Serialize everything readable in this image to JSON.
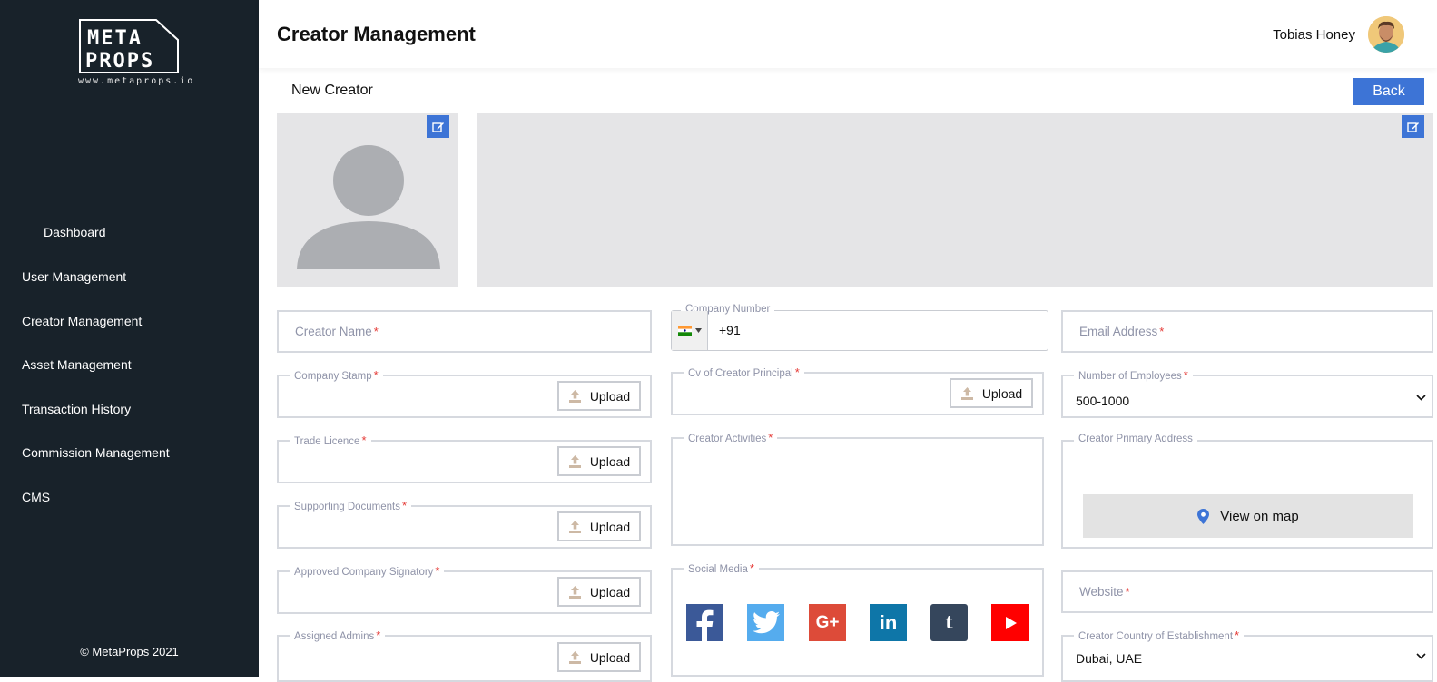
{
  "sidebar": {
    "logo_text_1": "META",
    "logo_text_2": "PROPS",
    "logo_url": "www.metaprops.io",
    "items": [
      {
        "label": "Dashboard"
      },
      {
        "label": "User Management"
      },
      {
        "label": "Creator Management"
      },
      {
        "label": "Asset Management"
      },
      {
        "label": "Transaction History"
      },
      {
        "label": "Commission Management"
      },
      {
        "label": "CMS"
      }
    ],
    "footer": "© MetaProps 2021"
  },
  "header": {
    "title": "Creator Management",
    "user_name": "Tobias Honey"
  },
  "page": {
    "subtitle": "New Creator",
    "back_label": "Back"
  },
  "form": {
    "creator_name": {
      "placeholder": "Creator Name",
      "required": "*"
    },
    "company_number": {
      "label": "Company Number",
      "country_code": "+91",
      "flag": "india-flag"
    },
    "email": {
      "placeholder": "Email Address",
      "required": "*"
    },
    "company_stamp": {
      "label": "Company Stamp",
      "required": "*"
    },
    "cv_principal": {
      "label": "Cv of Creator Principal",
      "required": "*"
    },
    "num_employees": {
      "label": "Number of Employees",
      "required": "*",
      "value": "500-1000"
    },
    "trade_licence": {
      "label": "Trade Licence",
      "required": "*"
    },
    "creator_activities": {
      "label": "Creator Activities",
      "required": "*"
    },
    "primary_address": {
      "label": "Creator Primary Address",
      "map_label": "View on map"
    },
    "supporting_docs": {
      "label": "Supporting Documents",
      "required": "*"
    },
    "approved_signatory": {
      "label": "Approved Company Signatory",
      "required": "*"
    },
    "social_media": {
      "label": "Social Media",
      "required": "*",
      "icons": [
        "facebook-icon",
        "twitter-icon",
        "google-plus-icon",
        "linkedin-icon",
        "tumblr-icon",
        "youtube-icon"
      ]
    },
    "website": {
      "placeholder": "Website",
      "required": "*"
    },
    "assigned_admins": {
      "label": "Assigned Admins",
      "required": "*"
    },
    "country": {
      "label": "Creator Country of Establishment",
      "required": "*",
      "value": "Dubai, UAE"
    },
    "upload_label": "Upload"
  },
  "colors": {
    "sidebar_bg": "#18222a",
    "accent": "#3d74d6",
    "required": "#e53935",
    "placeholder_box": "#e5e5e7"
  }
}
